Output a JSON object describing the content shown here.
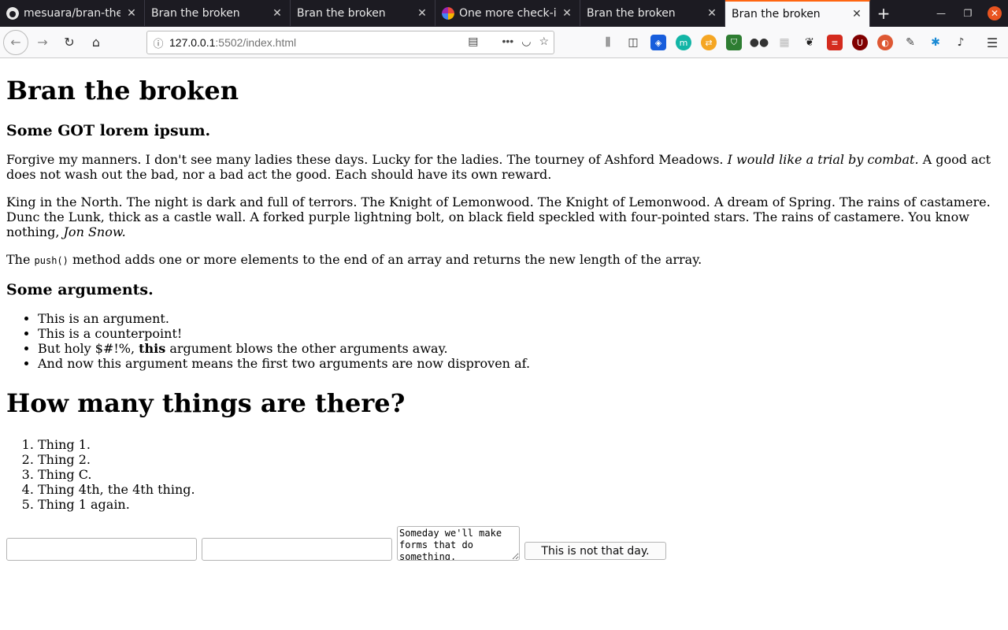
{
  "browser": {
    "tabs": [
      {
        "label": "mesuara/bran-the",
        "favicon": "github-icon"
      },
      {
        "label": "Bran the broken"
      },
      {
        "label": "Bran the broken"
      },
      {
        "label": "One more check-in",
        "favicon": "colorful-circle-icon"
      },
      {
        "label": "Bran the broken"
      },
      {
        "label": "Bran the broken",
        "active": true
      }
    ],
    "url_host": "127.0.0.1",
    "url_path": ":5502/index.html",
    "accent": "#ff6611"
  },
  "page": {
    "title": "Bran the broken",
    "subtitle": "Some GOT lorem ipsum.",
    "para1_a": "Forgive my manners. I don't see many ladies these days. Lucky for the ladies. The tourney of Ashford Meadows. ",
    "para1_em": "I would like a trial by combat.",
    "para1_b": " A good act does not wash out the bad, nor a bad act the good. Each should have its own reward.",
    "para2_a": "King in the North. The night is dark and full of terrors. The Knight of Lemonwood. The Knight of Lemonwood. A dream of Spring. The rains of castamere. Dunc the Lunk, thick as a castle wall. A forked purple lightning bolt, on black field speckled with four-pointed stars. The rains of castamere. You know nothing, ",
    "para2_em": "Jon Snow.",
    "para3_a": "The ",
    "para3_code": "push()",
    "para3_b": " method adds one or more elements to the end of an array and returns the new length of the array.",
    "args_heading": "Some arguments.",
    "args": {
      "item1": "This is an argument.",
      "item2": "This is a counterpoint!",
      "item3_a": "But holy $#!%, ",
      "item3_strong": "this",
      "item3_b": " argument blows the other arguments away.",
      "item4": "And now this argument means the first two arguments are now disproven af."
    },
    "things_heading": "How many things are there?",
    "things": [
      "Thing 1.",
      "Thing 2.",
      "Thing C.",
      "Thing 4th, the 4th thing.",
      "Thing 1 again."
    ],
    "form": {
      "input1": "",
      "input2": "",
      "textarea": "Someday we'll make forms that do something.",
      "button": "This is not that day."
    }
  }
}
